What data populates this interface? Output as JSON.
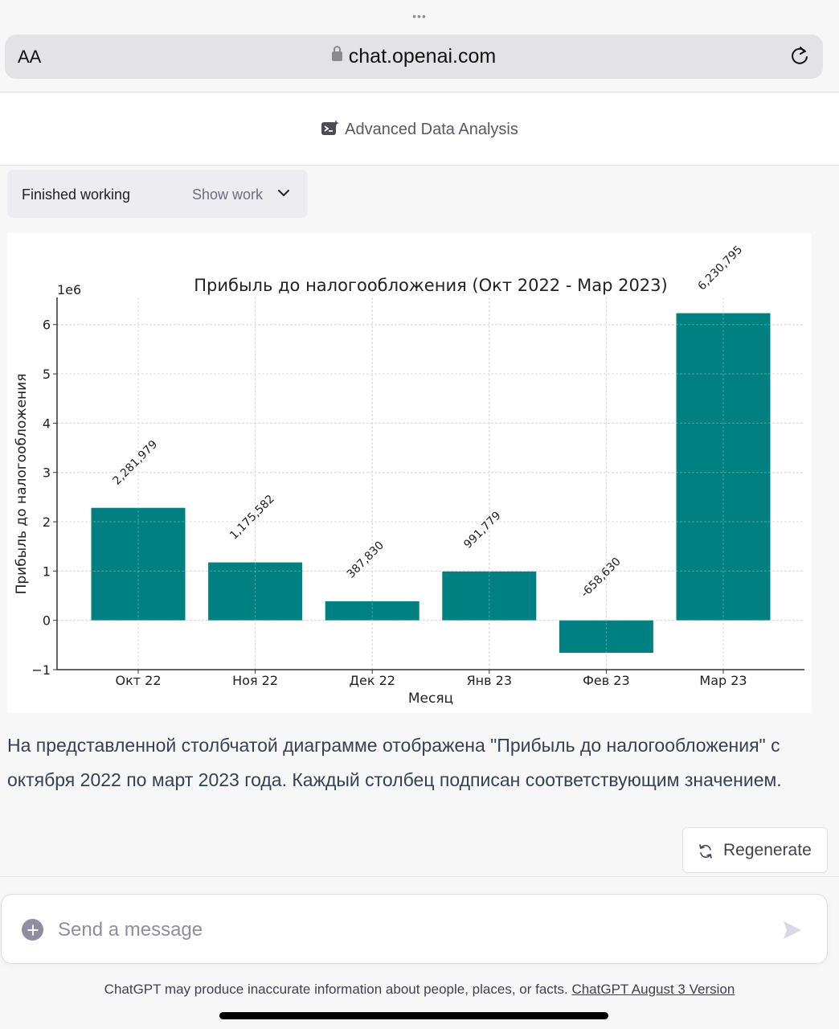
{
  "browser": {
    "more_dots": "•••",
    "text_size_label": "AA",
    "url": "chat.openai.com",
    "icons": {
      "lock": "lock-icon",
      "reload": "reload-icon"
    }
  },
  "header": {
    "title": "Advanced Data Analysis",
    "icon": "data-analysis-icon"
  },
  "work_status": {
    "status": "Finished working",
    "toggle_label": "Show work",
    "icon": "chevron-down-icon"
  },
  "chart_data": {
    "type": "bar",
    "title": "Прибыль до налогообложения (Окт 2022 - Мар 2023)",
    "xlabel": "Месяц",
    "ylabel": "Прибыль до налогообложения",
    "y_scale_label": "1e6",
    "categories": [
      "Окт 22",
      "Ноя 22",
      "Дек 22",
      "Янв 23",
      "Фев 23",
      "Мар 23"
    ],
    "values": [
      2281979,
      1175582,
      387830,
      991779,
      -658630,
      6230795
    ],
    "data_labels": [
      "2,281,979",
      "1,175,582",
      "387,830",
      "991,779",
      "-658,630",
      "6,230,795"
    ],
    "yticks": [
      -1,
      0,
      1,
      2,
      3,
      4,
      5,
      6
    ],
    "ytick_labels": [
      "−1",
      "0",
      "1",
      "2",
      "3",
      "4",
      "5",
      "6"
    ],
    "ylim": [
      -1000000,
      6550000
    ],
    "grid": true,
    "bar_color": "#008080",
    "legend": "none"
  },
  "message": {
    "text": "На представленной столбчатой диаграмме отображена \"Прибыль до налогообложения\" с октября 2022 по март 2023 года. Каждый столбец подписан соответствующим значением."
  },
  "regenerate": {
    "label": "Regenerate",
    "icon": "refresh-icon"
  },
  "composer": {
    "placeholder": "Send a message",
    "value": "",
    "icons": {
      "attach": "plus-icon",
      "send": "send-icon"
    }
  },
  "footer": {
    "disclaimer": "ChatGPT may produce inaccurate information about people, places, or facts. ",
    "version_link": "ChatGPT August 3 Version"
  }
}
